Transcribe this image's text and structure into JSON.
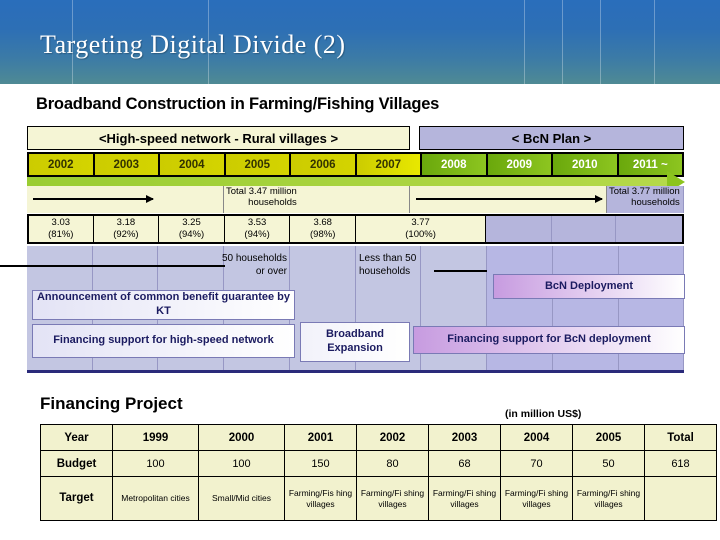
{
  "header": {
    "title": "Targeting Digital Divide (2)"
  },
  "section": {
    "heading": "Broadband Construction in Farming/Fishing Villages"
  },
  "diagram": {
    "band_left": "<High-speed network - Rural villages >",
    "band_right": "< BcN Plan >",
    "years": [
      {
        "label": "2002",
        "style": "y"
      },
      {
        "label": "2003",
        "style": "y"
      },
      {
        "label": "2004",
        "style": "y"
      },
      {
        "label": "2005",
        "style": "y"
      },
      {
        "label": "2006",
        "style": "y"
      },
      {
        "label": "2007",
        "style": "y"
      },
      {
        "label": "2008",
        "style": "g"
      },
      {
        "label": "2009",
        "style": "g"
      },
      {
        "label": "2010",
        "style": "g"
      },
      {
        "label": "2011 ~",
        "style": "g"
      }
    ],
    "total_left_line1": "Total 3.47 million",
    "total_left_line2": "households",
    "total_right_line1": "Total 3.77 million",
    "total_right_line2": "households",
    "percentages": [
      {
        "value": "3.03",
        "pct": "(81%)"
      },
      {
        "value": "3.18",
        "pct": "(92%)"
      },
      {
        "value": "3.25",
        "pct": "(94%)"
      },
      {
        "value": "3.53",
        "pct": "(94%)"
      },
      {
        "value": "3.68",
        "pct": "(98%)"
      },
      {
        "value": "3.77",
        "pct": "(100%)"
      }
    ],
    "hh_over_line1": "50 households",
    "hh_over_line2": "or over",
    "hh_under_line1": "Less than 50",
    "hh_under_line2": "households",
    "box_kt": "Announcement of common benefit guarantee by KT",
    "box_financing_hs": "Financing support for high-speed network",
    "box_broadband": "Broadband Expansion",
    "box_bcn_deploy": "BcN Deployment",
    "box_financing_bcn": "Financing support for BcN deployment"
  },
  "financing": {
    "title": "Financing Project",
    "unit_note": "(in million US$)",
    "rows": [
      {
        "label": "Year",
        "cells": [
          "1999",
          "2000",
          "2001",
          "2002",
          "2003",
          "2004",
          "2005",
          "Total"
        ]
      },
      {
        "label": "Budget",
        "cells": [
          "100",
          "100",
          "150",
          "80",
          "68",
          "70",
          "50",
          "618"
        ]
      },
      {
        "label": "Target",
        "cells": [
          "Metropolitan cities",
          "Small/Mid cities",
          "Farming/Fis hing villages",
          "Farming/Fi shing villages",
          "Farming/Fi shing villages",
          "Farming/Fi shing villages",
          "Farming/Fi shing villages",
          ""
        ]
      }
    ]
  }
}
